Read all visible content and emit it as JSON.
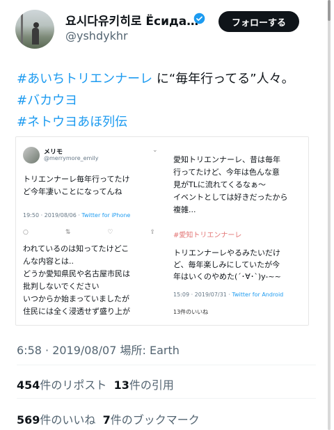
{
  "author": {
    "name": "요시다유키히로 Ёсида…",
    "handle": "@yshdykhr"
  },
  "follow_button": "フォローする",
  "tweet": {
    "line1_hashtag": "#あいちトリエンナーレ",
    "line1_rest": " に“毎年行ってる”人々。",
    "hashtag2": "#バカウヨ",
    "hashtag3": "#ネトウヨあほ列伝"
  },
  "embedded": {
    "left": {
      "name": "メリモ",
      "handle": "@merrymore_emily",
      "text_l1": "トリエンナーレ毎年行ってたけ",
      "text_l2": "ど今年凄いことになってんね",
      "time": "19:50 · 2019/08/06 · ",
      "source": "Twitter for iPhone",
      "text2_l1": "われているのは知ってたけどこ",
      "text2_l2": "んな内容とは..",
      "text2_l3": "どうか愛知県民や名古屋市民は",
      "text2_l4": "批判しないでください",
      "text2_l5": "いつからか始まっていましたが",
      "text2_l6": "住民には全く浸透せず盛り上が"
    },
    "right": {
      "text_l1": "愛知トリエンナーレ、昔は毎年",
      "text_l2": "行ってたけど、今年は色んな意",
      "text_l3": "見がTLに流れてくるなぁ〜",
      "text_l4": "イベントとしては好きだったから",
      "text_l5": "複雑...",
      "quote_stub": "#愛知トリエンナーレ",
      "text2_l1": "トリエンナーレやるみたいだけ",
      "text2_l2": "ど、毎年楽しみにしていたが今",
      "text2_l3": "年はいくのやめた(´･∀･`)y-~~",
      "time": "15:09 · 2019/07/31 · ",
      "source": "Twitter for Android",
      "likes": "13件のいいね"
    }
  },
  "timestamp": "6:58 · 2019/08/07 場所: Earth",
  "stats": {
    "retweets_count": "454",
    "retweets_label": "件のリポスト",
    "quotes_count": "13",
    "quotes_label": "件の引用",
    "likes_count": "569",
    "likes_label": "件のいいね",
    "bookmarks_count": "7",
    "bookmarks_label": "件のブックマーク"
  },
  "colors": {
    "accent": "#1d9bf0",
    "text": "#0f1419",
    "muted": "#536471"
  }
}
